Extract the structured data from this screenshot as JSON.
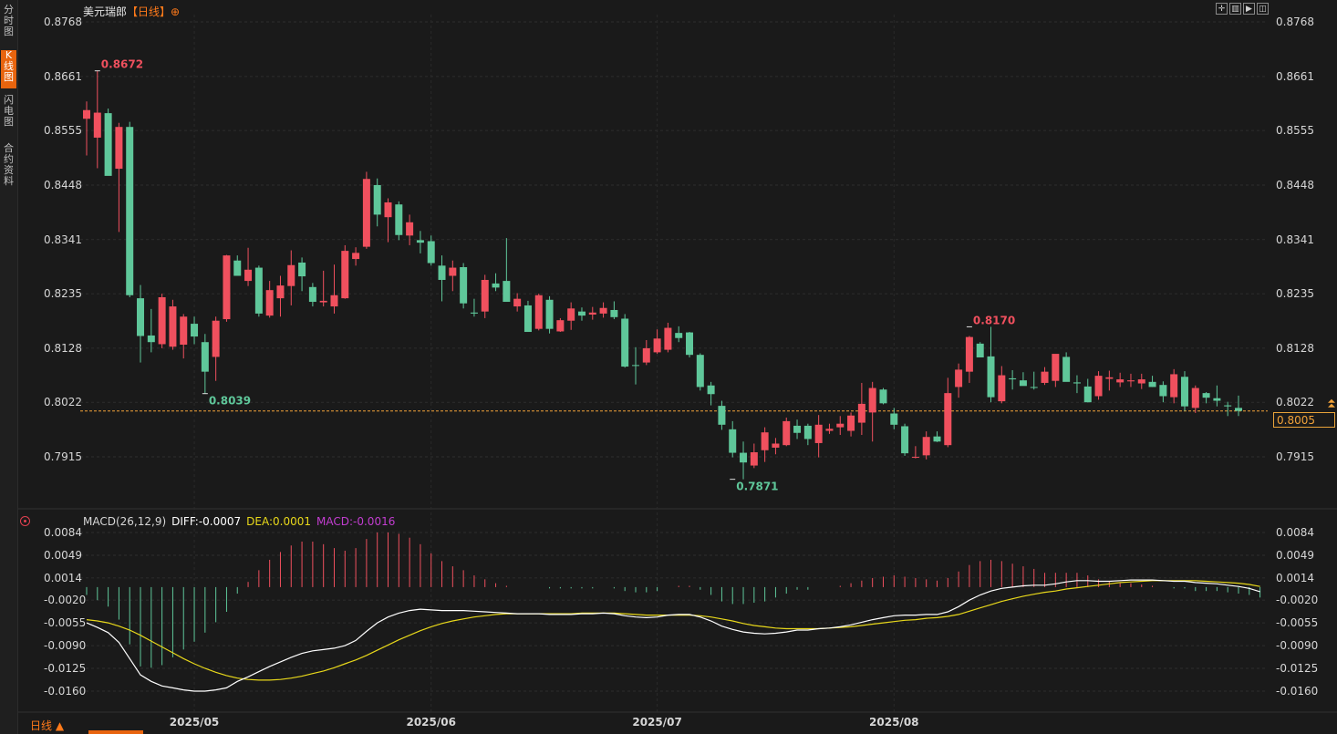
{
  "sidebar": {
    "tabs": [
      {
        "label": "分时图",
        "active": false
      },
      {
        "label": "K线图",
        "active": true
      },
      {
        "label": "闪电图",
        "active": false
      },
      {
        "label": "合约资料",
        "active": false
      }
    ]
  },
  "header": {
    "symbol": "美元瑞郎",
    "period": "【日线】",
    "period_icon": "⊕"
  },
  "toolbar": {
    "icons": [
      "crosshair-icon",
      "bar-chart-icon",
      "play-icon",
      "chart-settings-icon"
    ]
  },
  "footer": {
    "period_select": "日线 ▲"
  },
  "colors": {
    "up": "#f0505e",
    "down": "#5fc79a",
    "diff": "#ffffff",
    "dea": "#e8d81a",
    "macd": "#c23dd0",
    "last_price": "#f2a33a"
  },
  "chart_data": [
    {
      "type": "candlestick",
      "title": "美元瑞郎 日线",
      "y_ticks": [
        "0.8768",
        "0.8661",
        "0.8555",
        "0.8448",
        "0.8341",
        "0.8235",
        "0.8128",
        "0.8022",
        "0.7915"
      ],
      "ylim": [
        0.7806,
        0.8768
      ],
      "x_ticks": [
        "2025/05",
        "2025/06",
        "2025/07",
        "2025/08"
      ],
      "x_tick_positions": [
        10,
        32,
        53,
        75
      ],
      "last_price": "0.8005",
      "annotations": [
        {
          "text": "0.8672",
          "index": 1,
          "value": 0.8672,
          "kind": "high"
        },
        {
          "text": "0.8039",
          "index": 11,
          "value": 0.8039,
          "kind": "low"
        },
        {
          "text": "0.7871",
          "index": 60,
          "value": 0.7871,
          "kind": "low"
        },
        {
          "text": "0.8170",
          "index": 82,
          "value": 0.817,
          "kind": "high"
        }
      ],
      "candles": [
        [
          0.8578,
          0.8612,
          0.8506,
          0.8595
        ],
        [
          0.8541,
          0.8672,
          0.8481,
          0.859
        ],
        [
          0.8589,
          0.8598,
          0.8483,
          0.8466
        ],
        [
          0.848,
          0.857,
          0.8356,
          0.8562
        ],
        [
          0.8562,
          0.8572,
          0.8228,
          0.8232
        ],
        [
          0.8226,
          0.8252,
          0.81,
          0.8152
        ],
        [
          0.8153,
          0.8205,
          0.812,
          0.814
        ],
        [
          0.8136,
          0.8235,
          0.8128,
          0.8228
        ],
        [
          0.8131,
          0.8223,
          0.8125,
          0.821
        ],
        [
          0.8135,
          0.8195,
          0.8108,
          0.819
        ],
        [
          0.8176,
          0.819,
          0.8136,
          0.8151
        ],
        [
          0.814,
          0.8156,
          0.8039,
          0.8082
        ],
        [
          0.8111,
          0.819,
          0.8064,
          0.8182
        ],
        [
          0.8185,
          0.8311,
          0.818,
          0.831
        ],
        [
          0.83,
          0.831,
          0.827,
          0.827
        ],
        [
          0.826,
          0.8325,
          0.825,
          0.8282
        ],
        [
          0.8286,
          0.829,
          0.819,
          0.8196
        ],
        [
          0.8192,
          0.826,
          0.8188,
          0.8242
        ],
        [
          0.8226,
          0.827,
          0.819,
          0.8251
        ],
        [
          0.825,
          0.832,
          0.8212,
          0.8291
        ],
        [
          0.8296,
          0.8306,
          0.824,
          0.8269
        ],
        [
          0.8248,
          0.8256,
          0.821,
          0.8219
        ],
        [
          0.8218,
          0.828,
          0.821,
          0.8221
        ],
        [
          0.821,
          0.8292,
          0.8196,
          0.8232
        ],
        [
          0.8226,
          0.833,
          0.8225,
          0.8319
        ],
        [
          0.8303,
          0.8326,
          0.829,
          0.8315
        ],
        [
          0.8327,
          0.8474,
          0.8323,
          0.846
        ],
        [
          0.8448,
          0.8461,
          0.8367,
          0.839
        ],
        [
          0.8385,
          0.8422,
          0.8336,
          0.8414
        ],
        [
          0.841,
          0.8416,
          0.834,
          0.835
        ],
        [
          0.8349,
          0.839,
          0.833,
          0.8375
        ],
        [
          0.834,
          0.8358,
          0.8314,
          0.8335
        ],
        [
          0.8338,
          0.8349,
          0.829,
          0.8295
        ],
        [
          0.829,
          0.831,
          0.822,
          0.8262
        ],
        [
          0.827,
          0.83,
          0.824,
          0.8286
        ],
        [
          0.8287,
          0.8295,
          0.8206,
          0.8216
        ],
        [
          0.8198,
          0.8225,
          0.819,
          0.8196
        ],
        [
          0.82,
          0.8272,
          0.8187,
          0.8262
        ],
        [
          0.8255,
          0.8275,
          0.824,
          0.8247
        ],
        [
          0.826,
          0.8344,
          0.8222,
          0.8219
        ],
        [
          0.821,
          0.8236,
          0.82,
          0.8225
        ],
        [
          0.8212,
          0.8221,
          0.816,
          0.816
        ],
        [
          0.8166,
          0.8235,
          0.8163,
          0.8232
        ],
        [
          0.8223,
          0.823,
          0.8157,
          0.8166
        ],
        [
          0.8161,
          0.8187,
          0.816,
          0.8183
        ],
        [
          0.8182,
          0.8218,
          0.8164,
          0.8206
        ],
        [
          0.82,
          0.8208,
          0.8182,
          0.8192
        ],
        [
          0.8194,
          0.8209,
          0.8184,
          0.8198
        ],
        [
          0.8196,
          0.8218,
          0.8188,
          0.8207
        ],
        [
          0.8203,
          0.822,
          0.8185,
          0.8189
        ],
        [
          0.8186,
          0.8195,
          0.809,
          0.8092
        ],
        [
          0.8095,
          0.813,
          0.8057,
          0.8094
        ],
        [
          0.81,
          0.8144,
          0.8095,
          0.8128
        ],
        [
          0.812,
          0.8165,
          0.8117,
          0.8147
        ],
        [
          0.8125,
          0.8178,
          0.812,
          0.8168
        ],
        [
          0.8158,
          0.8171,
          0.814,
          0.8148
        ],
        [
          0.8159,
          0.816,
          0.811,
          0.8115
        ],
        [
          0.8115,
          0.8118,
          0.8045,
          0.8052
        ],
        [
          0.8055,
          0.8062,
          0.8016,
          0.8038
        ],
        [
          0.8015,
          0.8025,
          0.7968,
          0.7978
        ],
        [
          0.7969,
          0.7985,
          0.7914,
          0.7923
        ],
        [
          0.7923,
          0.7945,
          0.7871,
          0.7904
        ],
        [
          0.7898,
          0.7941,
          0.7893,
          0.7924
        ],
        [
          0.7928,
          0.7973,
          0.7905,
          0.7963
        ],
        [
          0.7933,
          0.7952,
          0.792,
          0.7941
        ],
        [
          0.7938,
          0.7992,
          0.7936,
          0.7985
        ],
        [
          0.7976,
          0.7988,
          0.795,
          0.7962
        ],
        [
          0.7976,
          0.798,
          0.7938,
          0.795
        ],
        [
          0.7942,
          0.7997,
          0.7914,
          0.7978
        ],
        [
          0.7966,
          0.798,
          0.796,
          0.797
        ],
        [
          0.7973,
          0.7995,
          0.7958,
          0.798
        ],
        [
          0.7966,
          0.8002,
          0.7955,
          0.7996
        ],
        [
          0.7982,
          0.806,
          0.7958,
          0.8019
        ],
        [
          0.8002,
          0.8062,
          0.7945,
          0.805
        ],
        [
          0.8047,
          0.805,
          0.8018,
          0.802
        ],
        [
          0.8,
          0.8011,
          0.7969,
          0.7978
        ],
        [
          0.7975,
          0.798,
          0.7917,
          0.7922
        ],
        [
          0.7914,
          0.7936,
          0.7912,
          0.7915
        ],
        [
          0.7918,
          0.7965,
          0.791,
          0.7954
        ],
        [
          0.7955,
          0.7965,
          0.7944,
          0.7945
        ],
        [
          0.7938,
          0.807,
          0.7934,
          0.804
        ],
        [
          0.8052,
          0.8098,
          0.8031,
          0.8086
        ],
        [
          0.8082,
          0.8152,
          0.806,
          0.815
        ],
        [
          0.8137,
          0.814,
          0.8112,
          0.811
        ],
        [
          0.8112,
          0.817,
          0.8022,
          0.8032
        ],
        [
          0.8024,
          0.8093,
          0.802,
          0.8075
        ],
        [
          0.8069,
          0.8085,
          0.8047,
          0.8067
        ],
        [
          0.8065,
          0.8081,
          0.8056,
          0.8054
        ],
        [
          0.8052,
          0.8082,
          0.8047,
          0.8051
        ],
        [
          0.806,
          0.8091,
          0.8056,
          0.8082
        ],
        [
          0.8064,
          0.8113,
          0.8052,
          0.8117
        ],
        [
          0.8111,
          0.812,
          0.8066,
          0.8062
        ],
        [
          0.8061,
          0.8075,
          0.804,
          0.8059
        ],
        [
          0.8053,
          0.8068,
          0.8022,
          0.8022
        ],
        [
          0.8034,
          0.8083,
          0.8027,
          0.8074
        ],
        [
          0.8068,
          0.8084,
          0.8045,
          0.8071
        ],
        [
          0.8061,
          0.808,
          0.8052,
          0.8067
        ],
        [
          0.8063,
          0.8078,
          0.8052,
          0.8065
        ],
        [
          0.8059,
          0.8078,
          0.8048,
          0.8067
        ],
        [
          0.8062,
          0.8074,
          0.8052,
          0.8052
        ],
        [
          0.8056,
          0.8063,
          0.8022,
          0.8034
        ],
        [
          0.8032,
          0.8087,
          0.802,
          0.8077
        ],
        [
          0.8072,
          0.8083,
          0.8005,
          0.8014
        ],
        [
          0.8011,
          0.8055,
          0.8001,
          0.805
        ],
        [
          0.804,
          0.8042,
          0.802,
          0.8031
        ],
        [
          0.803,
          0.8055,
          0.8014,
          0.8025
        ],
        [
          0.8016,
          0.8023,
          0.7995,
          0.8014
        ],
        [
          0.8011,
          0.8035,
          0.7995,
          0.8005
        ]
      ]
    },
    {
      "type": "macd",
      "title": "MACD(26,12,9)",
      "labels": {
        "diff": "DIFF:-0.0007",
        "dea": "DEA:0.0001",
        "macd": "MACD:-0.0016"
      },
      "y_ticks": [
        "0.0084",
        "0.0049",
        "0.0014",
        "-0.0020",
        "-0.0055",
        "-0.0090",
        "-0.0125",
        "-0.0160"
      ],
      "ylim": [
        -0.016,
        0.0084
      ],
      "diff": [
        -0.0055,
        -0.0062,
        -0.007,
        -0.0085,
        -0.011,
        -0.0135,
        -0.0145,
        -0.0152,
        -0.0155,
        -0.0158,
        -0.016,
        -0.016,
        -0.0158,
        -0.0155,
        -0.0145,
        -0.0138,
        -0.013,
        -0.0122,
        -0.0115,
        -0.0108,
        -0.0102,
        -0.0098,
        -0.0096,
        -0.0094,
        -0.009,
        -0.0082,
        -0.0068,
        -0.0055,
        -0.0046,
        -0.004,
        -0.0036,
        -0.0034,
        -0.0035,
        -0.0036,
        -0.0036,
        -0.0036,
        -0.0037,
        -0.0038,
        -0.0039,
        -0.004,
        -0.0041,
        -0.0041,
        -0.0041,
        -0.0042,
        -0.0042,
        -0.0042,
        -0.0041,
        -0.0041,
        -0.004,
        -0.0041,
        -0.0044,
        -0.0046,
        -0.0047,
        -0.0046,
        -0.0043,
        -0.0042,
        -0.0042,
        -0.0046,
        -0.0052,
        -0.006,
        -0.0065,
        -0.0069,
        -0.0071,
        -0.0072,
        -0.0071,
        -0.0069,
        -0.0066,
        -0.0066,
        -0.0064,
        -0.0063,
        -0.0061,
        -0.0058,
        -0.0054,
        -0.005,
        -0.0047,
        -0.0044,
        -0.0043,
        -0.0043,
        -0.0042,
        -0.0042,
        -0.0038,
        -0.003,
        -0.002,
        -0.0012,
        -0.0006,
        -0.0002,
        0.0,
        0.0002,
        0.0003,
        0.0003,
        0.0005,
        0.0008,
        0.001,
        0.001,
        0.0009,
        0.0009,
        0.001,
        0.0011,
        0.0011,
        0.0011,
        0.001,
        0.0009,
        0.0009,
        0.0007,
        0.0006,
        0.0005,
        0.0003,
        0.0001,
        -0.0002,
        -0.0007
      ],
      "dea": [
        -0.005,
        -0.0052,
        -0.0055,
        -0.006,
        -0.0066,
        -0.0074,
        -0.0083,
        -0.0092,
        -0.0101,
        -0.011,
        -0.0118,
        -0.0125,
        -0.0131,
        -0.0136,
        -0.014,
        -0.0142,
        -0.0143,
        -0.0143,
        -0.0142,
        -0.014,
        -0.0137,
        -0.0133,
        -0.0129,
        -0.0124,
        -0.0118,
        -0.0112,
        -0.0105,
        -0.0097,
        -0.0089,
        -0.0081,
        -0.0074,
        -0.0067,
        -0.0061,
        -0.0056,
        -0.0052,
        -0.0049,
        -0.0046,
        -0.0044,
        -0.0042,
        -0.0041,
        -0.0041,
        -0.0041,
        -0.0041,
        -0.0041,
        -0.0041,
        -0.0041,
        -0.004,
        -0.004,
        -0.004,
        -0.004,
        -0.0041,
        -0.0042,
        -0.0043,
        -0.0043,
        -0.0043,
        -0.0043,
        -0.0043,
        -0.0044,
        -0.0046,
        -0.0049,
        -0.0052,
        -0.0056,
        -0.0059,
        -0.0061,
        -0.0063,
        -0.0064,
        -0.0064,
        -0.0064,
        -0.0064,
        -0.0063,
        -0.0062,
        -0.0061,
        -0.0059,
        -0.0057,
        -0.0055,
        -0.0053,
        -0.0051,
        -0.005,
        -0.0048,
        -0.0047,
        -0.0045,
        -0.0042,
        -0.0037,
        -0.0032,
        -0.0027,
        -0.0022,
        -0.0018,
        -0.0014,
        -0.0011,
        -0.0008,
        -0.0006,
        -0.0003,
        -0.0001,
        0.0001,
        0.0003,
        0.0005,
        0.0007,
        0.0008,
        0.0009,
        0.001,
        0.001,
        0.001,
        0.001,
        0.001,
        0.0009,
        0.0008,
        0.0007,
        0.0006,
        0.0004,
        0.0001
      ],
      "macd_hist": [
        -0.0012,
        -0.002,
        -0.003,
        -0.005,
        -0.0088,
        -0.0122,
        -0.0124,
        -0.012,
        -0.0108,
        -0.0096,
        -0.0084,
        -0.007,
        -0.0054,
        -0.0038,
        -0.001,
        0.0008,
        0.0026,
        0.0042,
        0.0054,
        0.0064,
        0.007,
        0.007,
        0.0066,
        0.006,
        0.0056,
        0.006,
        0.0074,
        0.0084,
        0.0084,
        0.0082,
        0.0076,
        0.0066,
        0.0052,
        0.004,
        0.0032,
        0.0026,
        0.0018,
        0.0012,
        0.0006,
        0.0002,
        0.0,
        0.0,
        0.0,
        -0.0002,
        -0.0002,
        -0.0002,
        -0.0002,
        -0.0002,
        0.0,
        -0.0002,
        -0.0006,
        -0.0008,
        -0.0008,
        -0.0006,
        0.0,
        0.0002,
        0.0002,
        -0.0004,
        -0.0012,
        -0.0022,
        -0.0026,
        -0.0026,
        -0.0024,
        -0.0022,
        -0.0016,
        -0.001,
        -0.0004,
        -0.0004,
        0.0,
        0.0,
        0.0002,
        0.0006,
        0.001,
        0.0014,
        0.0016,
        0.0018,
        0.0016,
        0.0014,
        0.0012,
        0.001,
        0.0014,
        0.0024,
        0.0034,
        0.004,
        0.0042,
        0.004,
        0.0036,
        0.0032,
        0.0028,
        0.0022,
        0.0022,
        0.0022,
        0.0022,
        0.0018,
        0.0012,
        0.0008,
        0.0006,
        0.0006,
        0.0004,
        0.0002,
        0.0,
        -0.0002,
        -0.0002,
        -0.0006,
        -0.0006,
        -0.0006,
        -0.0008,
        -0.001,
        -0.0012,
        -0.0016
      ]
    }
  ]
}
